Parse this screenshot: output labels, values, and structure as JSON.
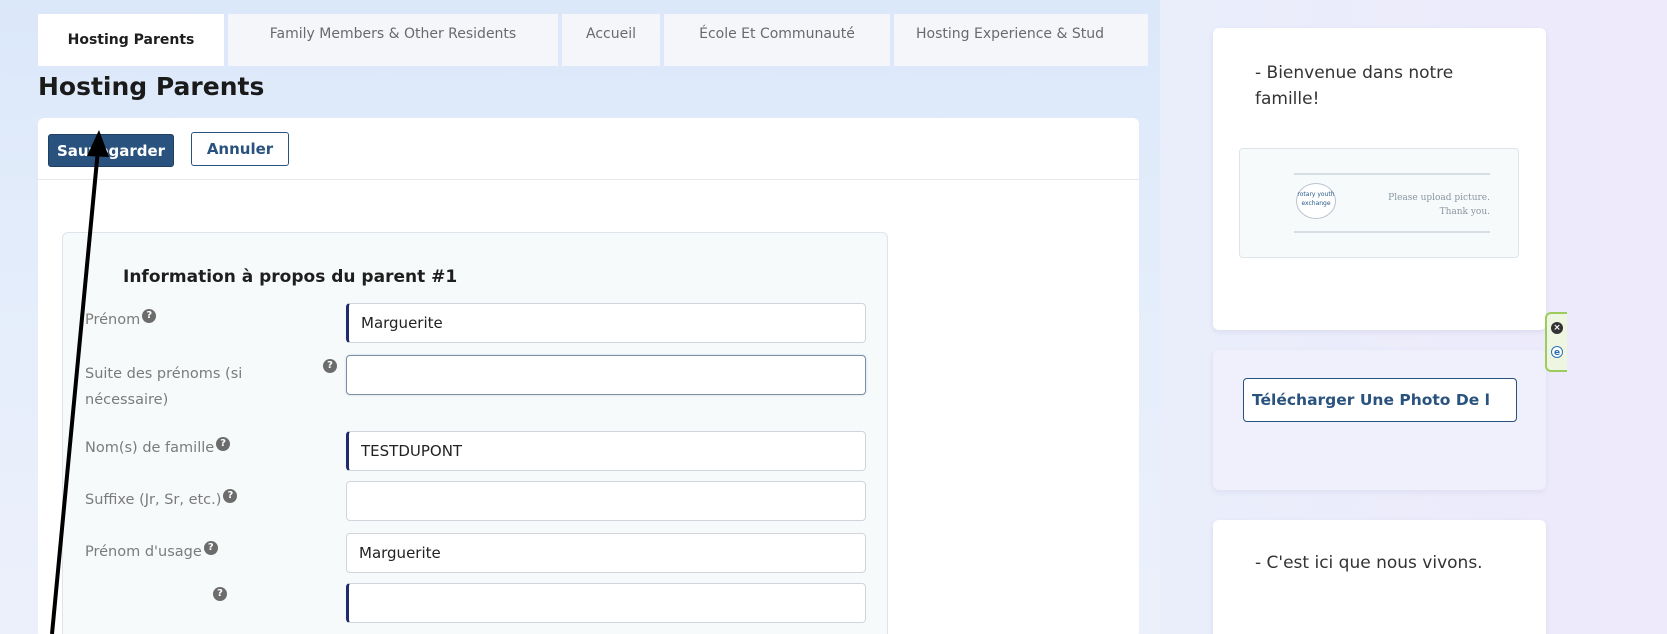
{
  "tabs": [
    {
      "label": "Hosting Parents",
      "active": true
    },
    {
      "label": "Family Members & Other Residents",
      "active": false
    },
    {
      "label": "Accueil",
      "active": false
    },
    {
      "label": "École Et Communauté",
      "active": false
    },
    {
      "label": "Hosting Experience & Stud",
      "active": false
    }
  ],
  "page": {
    "title": "Hosting Parents"
  },
  "toolbar": {
    "save_label": "Sauvegarder",
    "cancel_label": "Annuler"
  },
  "form": {
    "section_title": "Information à propos du parent #1",
    "help_glyph": "?",
    "fields": [
      {
        "label": "Prénom",
        "value": "Marguerite"
      },
      {
        "label": "Suite des prénoms (si nécessaire)",
        "value": ""
      },
      {
        "label": "Nom(s) de famille",
        "value": "TESTDUPONT"
      },
      {
        "label": "Suffixe (Jr, Sr, etc.)",
        "value": ""
      },
      {
        "label": "Prénom d'usage",
        "value": "Marguerite"
      },
      {
        "label": "",
        "value": ""
      }
    ]
  },
  "sidebar": {
    "welcome_text": "- Bienvenue dans notre famille!",
    "placeholder_logo": "rotary youth exchange",
    "placeholder_text_1": "Please upload picture.",
    "placeholder_text_2": "Thank you.",
    "upload_button": "Télécharger Une Photo De l",
    "home_text": "- C'est ici que nous vivons."
  },
  "colors": {
    "primary": "#29527e",
    "required_marker": "#1f2b6b",
    "annotation_arrow": "#000000",
    "widget_border": "#9ccc5c"
  },
  "icons": {
    "help": "question-circle-icon",
    "widget_close": "close-circle-icon",
    "widget_e": "e-circle-icon",
    "annotation": "arrow-annotation-icon"
  }
}
